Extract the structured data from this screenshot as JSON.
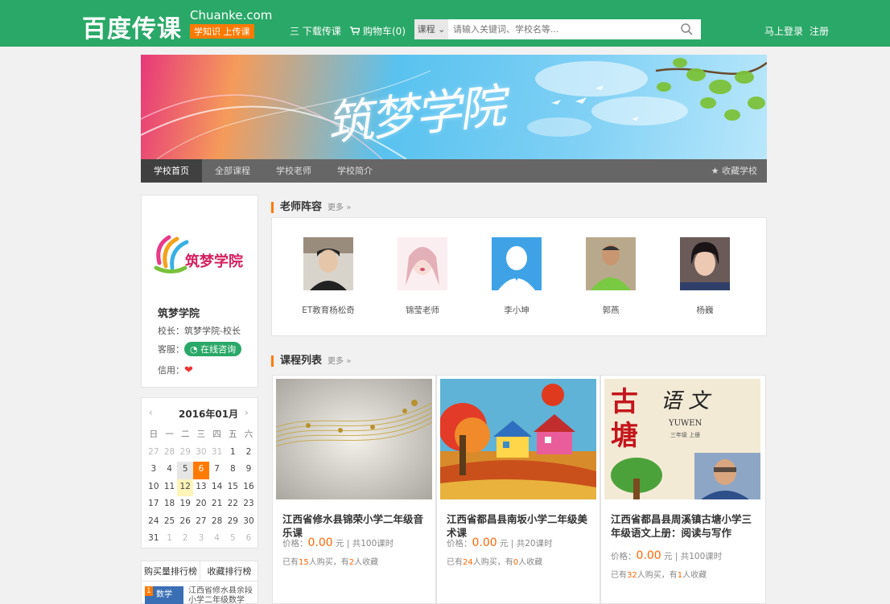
{
  "header": {
    "logo": "百度传课",
    "brand_en": "Chuanke.com",
    "brand_tag": "学知识 上传课",
    "download": "三 下载传课",
    "cart": "购物车(0)",
    "search_category": "课程 ⌄",
    "search_placeholder": "请输入关键词、学校名等...",
    "login": "马上登录",
    "register": "注册"
  },
  "banner": {
    "title": "筑梦学院"
  },
  "school_nav": {
    "items": [
      "学校首页",
      "全部课程",
      "学校老师",
      "学校简介"
    ],
    "favorite": "收藏学校"
  },
  "school": {
    "logo_text": "筑梦学院",
    "name": "筑梦学院",
    "principal": "校长：筑梦学院-校长",
    "service_label": "客服：",
    "service_btn": "在线咨询",
    "credit_label": "信用："
  },
  "calendar": {
    "month": "2016年01月",
    "prev": "‹",
    "next": "›",
    "weekdays": [
      "日",
      "一",
      "二",
      "三",
      "四",
      "五",
      "六"
    ],
    "weeks": [
      [
        "27",
        "28",
        "29",
        "30",
        "31",
        "1",
        "2"
      ],
      [
        "3",
        "4",
        "5",
        "6",
        "7",
        "8",
        "9"
      ],
      [
        "10",
        "11",
        "12",
        "13",
        "14",
        "15",
        "16"
      ],
      [
        "17",
        "18",
        "19",
        "20",
        "21",
        "22",
        "23"
      ],
      [
        "24",
        "25",
        "26",
        "27",
        "28",
        "29",
        "30"
      ],
      [
        "31",
        "1",
        "2",
        "3",
        "4",
        "5",
        "6"
      ]
    ]
  },
  "rank_tabs": [
    "购买量排行榜",
    "收藏排行榜"
  ],
  "rank_preview": {
    "badge": "数学",
    "text": "江西省修水县余段小学二年级数学"
  },
  "teachers_section": {
    "title": "老师阵容",
    "more": "更多 »"
  },
  "teachers": [
    {
      "name": "ET教育杨松奇"
    },
    {
      "name": "锦莹老师"
    },
    {
      "name": "李小坤"
    },
    {
      "name": "郭燕"
    },
    {
      "name": "杨巍"
    }
  ],
  "courses_section": {
    "title": "课程列表",
    "more": "更多 »"
  },
  "courses": [
    {
      "title": "江西省修水县锦荣小学二年级音乐课",
      "price_label": "价格：",
      "price": "0.00",
      "price_tail": "元 | 共100课时",
      "buy_a": "已有",
      "buyers": "15",
      "buy_b": "人购买，有",
      "favs": "2",
      "buy_c": "人收藏"
    },
    {
      "title": "江西省都昌县南坂小学二年级美术课",
      "price_label": "价格：",
      "price": "0.00",
      "price_tail": "元 | 共20课时",
      "buy_a": "已有",
      "buyers": "24",
      "buy_b": "人购买，有",
      "favs": "0",
      "buy_c": "人收藏"
    },
    {
      "title": "江西省都昌县周溪镇古塘小学三年级语文上册：阅读与写作",
      "price_label": "价格：",
      "price": "0.00",
      "price_tail": "元 | 共100课时",
      "buy_a": "已有",
      "buyers": "32",
      "buy_b": "人购买，有",
      "favs": "1",
      "buy_c": "人收藏"
    }
  ],
  "course3_img": {
    "title_1": "古",
    "title_2": "塘",
    "title_3": "语 文",
    "sub": "YUWEN",
    "grade": "三年级 上册"
  }
}
